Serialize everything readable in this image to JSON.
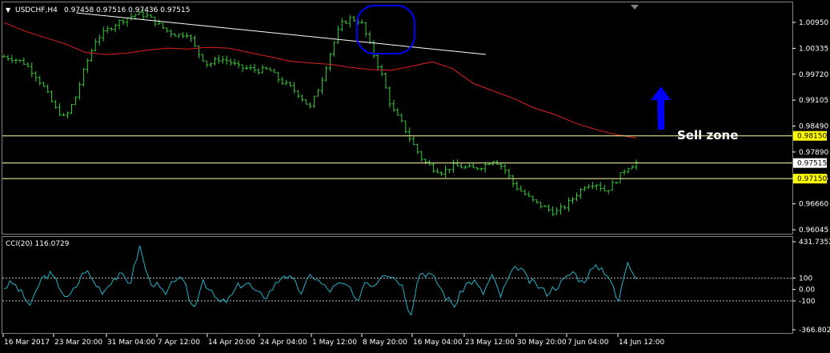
{
  "header": {
    "menu_glyph": "▼",
    "symbol_tf": "USDCHF,H4",
    "ohlc": "0.97458 0.97516 0.97436 0.97515"
  },
  "annotation": {
    "text": "Sell zone"
  },
  "indicator": {
    "label": "CCI(20) 116.0729"
  },
  "price_axis": {
    "ticks": [
      "1.00950",
      "1.00335",
      "0.99720",
      "0.99105",
      "0.98490",
      "0.97890",
      "0.97275",
      "0.96660",
      "0.96045"
    ],
    "highlight_labels": [
      {
        "text": "0.98150",
        "color": "#ffff00"
      },
      {
        "text": "0.97515",
        "color": "#ffffff"
      },
      {
        "text": "0.97150",
        "color": "#ffff00"
      }
    ]
  },
  "cci_axis": {
    "ticks": [
      "431.7352",
      "100",
      "0.00",
      "-100",
      "-366.8026"
    ]
  },
  "time_axis": {
    "labels": [
      "16 Mar 2017",
      "23 Mar 20:00",
      "31 Mar 04:00",
      "7 Apr 12:00",
      "14 Apr 20:00",
      "24 Apr 04:00",
      "1 May 12:00",
      "8 May 20:00",
      "16 May 04:00",
      "23 May 12:00",
      "30 May 20:00",
      "7 Jun 04:00",
      "14 Jun 12:00"
    ]
  },
  "colors": {
    "background": "#000000",
    "candles": "#33cc33",
    "ma_line": "#e02020",
    "levels": "#ffffaa",
    "trendline": "#ffffff",
    "highlight_ellipse": "#0000ff",
    "arrow": "#0000ff",
    "cci_line": "#20b2c8",
    "cci_levels": "#c0c0c0"
  },
  "chart_data": {
    "type": "line",
    "price_series_name": "USDCHF,H4",
    "ylim": [
      0.959,
      1.0125
    ],
    "price_close_path": [
      1.0,
      0.9995,
      0.9985,
      0.996,
      0.9925,
      0.988,
      0.9855,
      0.9905,
      0.998,
      1.004,
      1.006,
      1.0078,
      1.009,
      1.01,
      1.0096,
      1.0078,
      1.006,
      1.005,
      1.0055,
      1.001,
      0.998,
      0.9995,
      0.999,
      0.9975,
      0.9972,
      0.9968,
      0.997,
      0.9945,
      0.993,
      0.991,
      0.988,
      0.9935,
      1.001,
      1.0075,
      1.009,
      1.0082,
      1.002,
      0.996,
      0.988,
      0.9845,
      0.98,
      0.976,
      0.974,
      0.973,
      0.9745,
      0.9742,
      0.9738,
      0.9745,
      0.976,
      0.974,
      0.97,
      0.968,
      0.966,
      0.9648,
      0.9635,
      0.965,
      0.9675,
      0.97,
      0.9705,
      0.9685,
      0.971,
      0.974,
      0.9752
    ],
    "ma_path": [
      1.008,
      1.006,
      1.0045,
      1.003,
      1.001,
      1.0005,
      1.0008,
      1.0015,
      1.002,
      1.0018,
      1.0022,
      1.002,
      1.001,
      1.0,
      0.999,
      0.9985,
      0.9982,
      0.9975,
      0.997,
      0.9968,
      0.9978,
      0.9988,
      0.9972,
      0.9938,
      0.992,
      0.9902,
      0.988,
      0.9865,
      0.9845,
      0.983,
      0.9818,
      0.981
    ],
    "levels": [
      0.9815,
      0.97515,
      0.9715
    ],
    "cci_ylim": [
      -366.8026,
      431.7352
    ],
    "cci_levels": [
      100,
      -100
    ],
    "cci_path": [
      20,
      60,
      -40,
      -150,
      80,
      140,
      50,
      -90,
      30,
      180,
      60,
      -20,
      95,
      120,
      60,
      380,
      90,
      30,
      -60,
      120,
      40,
      -180,
      100,
      -40,
      -120,
      -80,
      40,
      60,
      -40,
      -60,
      40,
      140,
      70,
      -30,
      140,
      60,
      -10,
      40,
      40,
      -120,
      80,
      40,
      160,
      120,
      60,
      -220,
      150,
      140,
      60,
      -80,
      -140,
      40,
      80,
      -40,
      120,
      -60,
      120,
      210,
      80,
      40,
      -30,
      20,
      80,
      160,
      60,
      170,
      200,
      120,
      -130,
      260,
      116
    ]
  }
}
